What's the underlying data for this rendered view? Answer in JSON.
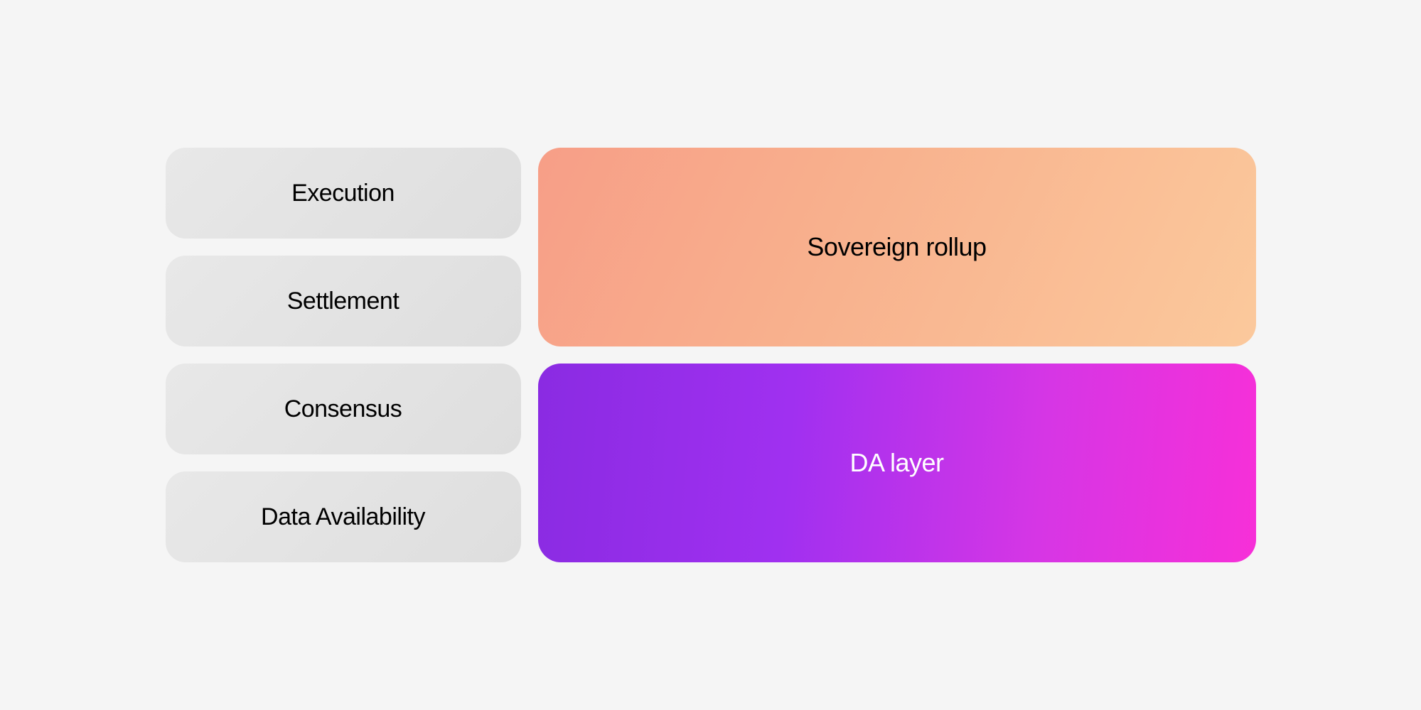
{
  "left_layers": {
    "execution": "Execution",
    "settlement": "Settlement",
    "consensus": "Consensus",
    "data_availability": "Data Availability"
  },
  "right_layers": {
    "sovereign_rollup": "Sovereign rollup",
    "da_layer": "DA layer"
  }
}
